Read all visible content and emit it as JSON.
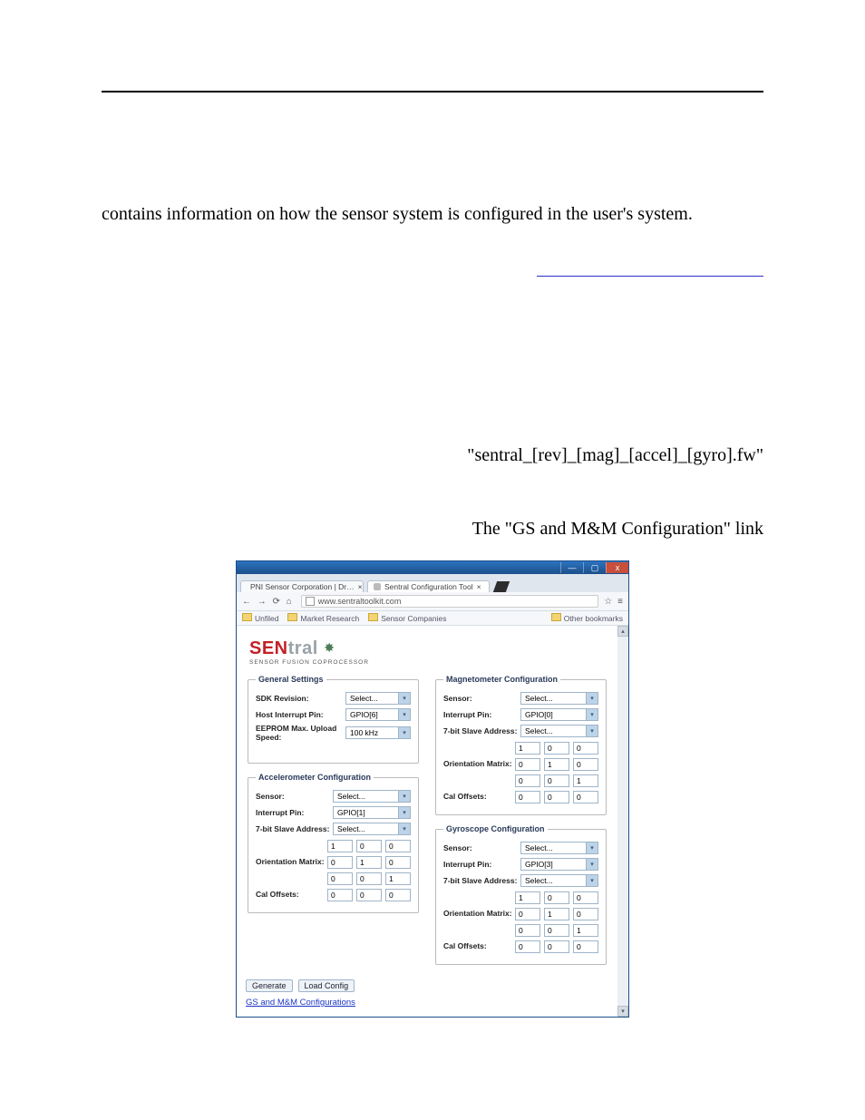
{
  "body": {
    "p1": "contains information on how the sensor system is configured in the user's system.",
    "p2_suffix": "\"sentral_[rev]_[mag]_[accel]_[gyro].fw\"",
    "p3_suffix": "The \"GS and M&M Configuration\" link"
  },
  "window": {
    "titlebar": {
      "minimize": "—",
      "maximize": "▢",
      "close": "x"
    },
    "tabs": [
      {
        "label": "PNI Sensor Corporation | Dr…"
      },
      {
        "label": "Sentral Configuration Tool"
      }
    ],
    "tab_close": "×",
    "toolbar": {
      "back": "←",
      "forward": "→",
      "reload": "⟳",
      "home": "⌂",
      "url": "www.sentraltoolkit.com",
      "star": "☆",
      "menu": "≡"
    },
    "bookmarks": {
      "items": [
        "Unfiled",
        "Market Research",
        "Sensor Companies"
      ],
      "other": "Other bookmarks"
    },
    "scroll": {
      "up": "▴",
      "down": "▾"
    },
    "logo": {
      "brand_a": "SEN",
      "brand_b": "tral",
      "sub": "SENSOR FUSION COPROCESSOR"
    },
    "labels": {
      "sdk": "SDK Revision:",
      "host_int": "Host Interrupt Pin:",
      "eeprom": "EEPROM Max. Upload Speed:",
      "sensor": "Sensor:",
      "int_pin": "Interrupt Pin:",
      "slave": "7-bit Slave Address:",
      "orient": "Orientation Matrix:",
      "cal": "Cal Offsets:"
    },
    "panels": {
      "general": "General Settings",
      "mag": "Magnetometer Configuration",
      "accel": "Accelerometer Configuration",
      "gyro": "Gyroscope Configuration"
    },
    "values": {
      "select_placeholder": "Select...",
      "gpio6": "GPIO[6]",
      "gpio1": "GPIO[1]",
      "gpio0": "GPIO[0]",
      "gpio3": "GPIO[3]",
      "speed": "100 kHz"
    },
    "identity_matrix": [
      [
        "1",
        "0",
        "0"
      ],
      [
        "0",
        "1",
        "0"
      ],
      [
        "0",
        "0",
        "1"
      ]
    ],
    "zero_row": [
      "0",
      "0",
      "0"
    ],
    "actions": {
      "generate": "Generate",
      "load": "Load Config"
    },
    "gs_link": "GS and M&M Configurations"
  }
}
